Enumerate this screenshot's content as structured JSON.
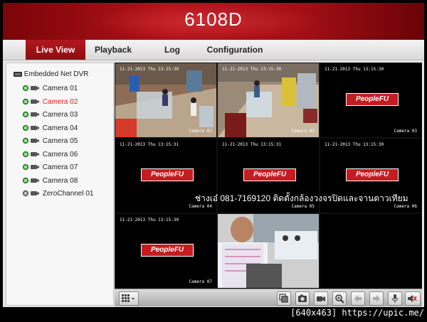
{
  "header": {
    "model": "6108D"
  },
  "nav": {
    "tabs": [
      "Live View",
      "Playback",
      "Log",
      "Configuration"
    ],
    "active_index": 0
  },
  "tree": {
    "root_label": "Embedded Net DVR",
    "items": [
      {
        "label": "Camera 01",
        "selected": false
      },
      {
        "label": "Camera 02",
        "selected": true
      },
      {
        "label": "Camera 03",
        "selected": false
      },
      {
        "label": "Camera 04",
        "selected": false
      },
      {
        "label": "Camera 05",
        "selected": false
      },
      {
        "label": "Camera 06",
        "selected": false
      },
      {
        "label": "Camera 07",
        "selected": false
      },
      {
        "label": "Camera 08",
        "selected": false
      },
      {
        "label": "ZeroChannel 01",
        "selected": false
      }
    ]
  },
  "tiles": [
    {
      "time": "11-21-2013 Thu 13:15:30",
      "name": "Camera 01",
      "type": "video1"
    },
    {
      "time": "11-21-2013 Thu 13:15:30",
      "name": "Camera 02",
      "type": "video2",
      "selected": true
    },
    {
      "time": "11-21-2013 Thu 13:15:30",
      "name": "Camera 03",
      "type": "logo"
    },
    {
      "time": "11-21-2013 Thu 13:15:31",
      "name": "Camera 04",
      "type": "logo"
    },
    {
      "time": "11-21-2013 Thu 13:15:31",
      "name": "Camera 05",
      "type": "logo"
    },
    {
      "time": "11-21-2013 Thu 13:15:30",
      "name": "Camera 06",
      "type": "logo"
    },
    {
      "time": "11-21-2013 Thu 13:15:30",
      "name": "Camera 07",
      "type": "logo"
    },
    {
      "time": "",
      "name": "",
      "type": "video8"
    },
    {
      "time": "",
      "name": "",
      "type": "empty"
    }
  ],
  "logo_text": "PeopleFU",
  "watermark": "ช่างเอ๋ 081-7169120 ติดตั้งกล้องวงจรปิดและจานดาวเทียม",
  "footer": "[640x463] https://upic.me/",
  "colors": {
    "accent": "#b3171e",
    "selected_text": "#e02020",
    "selected_tile": "#d6b34a"
  },
  "toolbar": {
    "left": [
      "layout-grid-icon"
    ],
    "right": [
      "record-all-icon",
      "snapshot-icon",
      "record-icon",
      "zoom-icon",
      "previous-page-icon",
      "next-page-icon",
      "microphone-icon",
      "volume-mute-icon"
    ]
  }
}
